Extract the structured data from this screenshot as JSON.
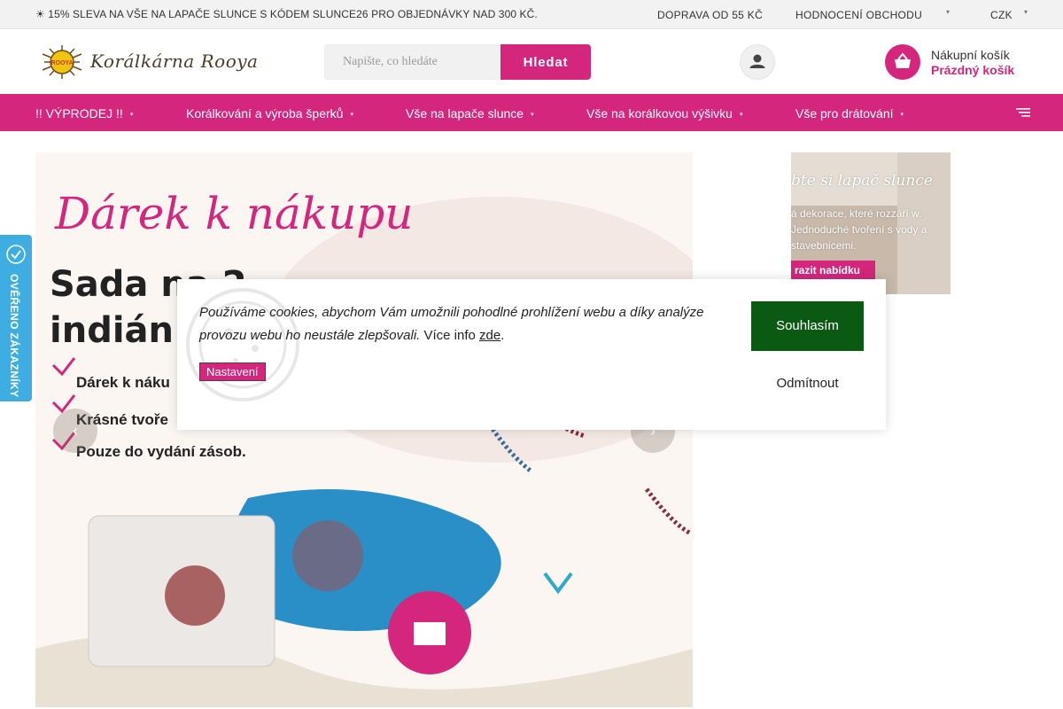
{
  "topbar": {
    "promo": "☀ 15% SLEVA NA VŠE NA LAPAČE SLUNCE S KÓDEM SLUNCE26 PRO OBJEDNÁVKY NAD 300 KČ.",
    "shipping": "DOPRAVA OD 55 KČ",
    "reviews": "HODNOCENÍ OBCHODU",
    "currency": "CZK"
  },
  "header": {
    "logo_text": "Korálkárna Rooya",
    "logo_badge": "ROOYA",
    "search_placeholder": "Napište, co hledáte",
    "search_button": "Hledat",
    "cart_title": "Nákupní košík",
    "cart_status": "Prázdný košík"
  },
  "nav": {
    "items": [
      "!! VÝPRODEJ !!",
      "Korálkování a výroba šperků",
      "Vše na lapače slunce",
      "Vše na korálkovou výšivku",
      "Vše pro drátování"
    ]
  },
  "hero": {
    "title": "Dárek k nákupu",
    "subtitle_line1": "Sada na 2",
    "subtitle_line2": "indián",
    "bullets": [
      "Dárek k náku",
      "Krásné tvoře",
      "Pouze do vydání zásob."
    ],
    "prev": "‹",
    "next": "›"
  },
  "side_banner": {
    "title": "bte si lapač slunce",
    "text": "á dekorace, které rozzáří w. Jednoduché tvoření s vody a stavebnicemi.",
    "button": "razit nabídku"
  },
  "verified_badge": {
    "text": "OVĚŘENO ZÁKAZNÍKY"
  },
  "cookie": {
    "message": "Používáme cookies, abychom Vám umožnili pohodlné prohlížení webu a díky analýze provozu webu ho neustále zlepšovali.",
    "more_info": "Více info",
    "link": "zde",
    "period": ".",
    "settings": "Nastavení",
    "agree": "Souhlasím",
    "decline": "Odmítnout"
  },
  "colors": {
    "brand": "#d4267c",
    "agree": "#0a5a14",
    "badge": "#3eaee2"
  }
}
